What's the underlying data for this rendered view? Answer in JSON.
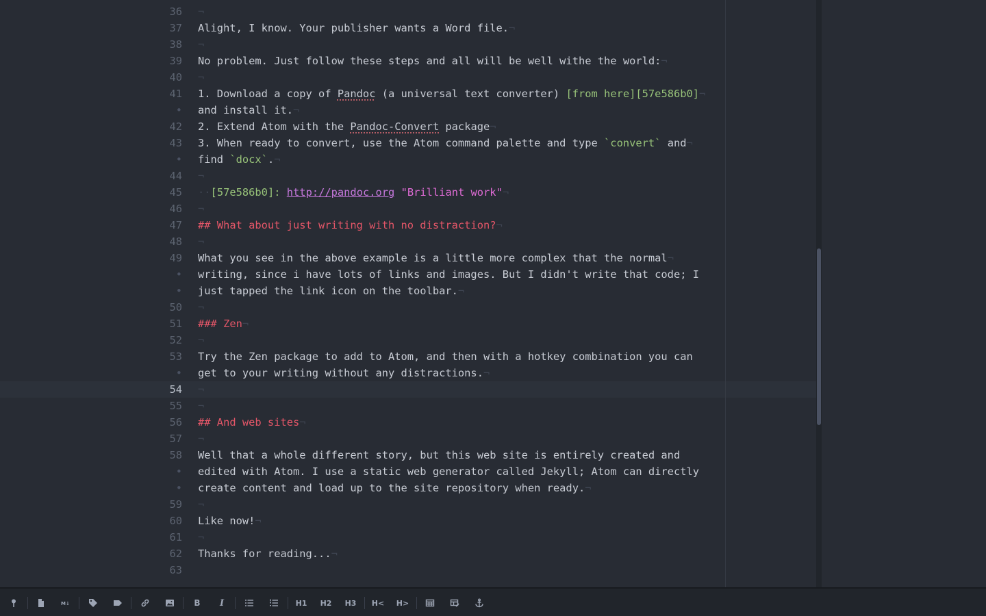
{
  "editor": {
    "lines": [
      {
        "num": "36",
        "parts": []
      },
      {
        "num": "37",
        "parts": [
          {
            "t": "Alight, I know. Your publisher wants a Word file."
          }
        ]
      },
      {
        "num": "38",
        "parts": []
      },
      {
        "num": "39",
        "parts": [
          {
            "t": "No problem. Just follow these steps and all will be well withe the world:"
          }
        ]
      },
      {
        "num": "40",
        "parts": []
      },
      {
        "num": "41",
        "parts": [
          {
            "t": "1. Download a copy of "
          },
          {
            "t": "Pandoc",
            "c": "sp"
          },
          {
            "t": " (a universal text converter) "
          },
          {
            "t": "[from here][57e586b0]",
            "c": "g"
          }
        ]
      },
      {
        "num": "•",
        "soft": true,
        "parts": [
          {
            "t": "and install it."
          }
        ]
      },
      {
        "num": "42",
        "parts": [
          {
            "t": "2. Extend Atom with the "
          },
          {
            "t": "Pandoc-Convert",
            "c": "sp"
          },
          {
            "t": " package"
          }
        ]
      },
      {
        "num": "43",
        "parts": [
          {
            "t": "3. When ready to convert, use the Atom command palette and type "
          },
          {
            "t": "`convert`",
            "c": "g"
          },
          {
            "t": " and"
          }
        ]
      },
      {
        "num": "•",
        "soft": true,
        "parts": [
          {
            "t": "find "
          },
          {
            "t": "`docx`",
            "c": "g"
          },
          {
            "t": "."
          }
        ]
      },
      {
        "num": "44",
        "parts": []
      },
      {
        "num": "45",
        "indent": "··",
        "parts": [
          {
            "t": "[57e586b0]:",
            "c": "g"
          },
          {
            "t": " "
          },
          {
            "t": "http://pandoc.org",
            "c": "m"
          },
          {
            "t": " "
          },
          {
            "t": "\"Brilliant work\"",
            "c": "p"
          }
        ]
      },
      {
        "num": "46",
        "parts": []
      },
      {
        "num": "47",
        "parts": [
          {
            "t": "## What about just writing with no distraction?",
            "c": "h"
          }
        ]
      },
      {
        "num": "48",
        "parts": []
      },
      {
        "num": "49",
        "parts": [
          {
            "t": "What you see in the above example is a little more complex that the normal"
          }
        ]
      },
      {
        "num": "•",
        "soft": true,
        "parts": [
          {
            "t": "writing, since i have lots of links and images. But I didn't write that code; I"
          }
        ],
        "noeol": true
      },
      {
        "num": "•",
        "soft": true,
        "parts": [
          {
            "t": "just tapped the link icon on the toolbar."
          }
        ]
      },
      {
        "num": "50",
        "parts": []
      },
      {
        "num": "51",
        "parts": [
          {
            "t": "### Zen",
            "c": "h"
          }
        ]
      },
      {
        "num": "52",
        "parts": []
      },
      {
        "num": "53",
        "parts": [
          {
            "t": "Try the Zen package to add to Atom, and then with a hotkey combination you can"
          }
        ],
        "noeol": true
      },
      {
        "num": "•",
        "soft": true,
        "parts": [
          {
            "t": "get to your writing without any distractions."
          }
        ]
      },
      {
        "num": "54",
        "cursor": true,
        "parts": []
      },
      {
        "num": "55",
        "parts": []
      },
      {
        "num": "56",
        "parts": [
          {
            "t": "## And web sites",
            "c": "h"
          }
        ]
      },
      {
        "num": "57",
        "parts": []
      },
      {
        "num": "58",
        "parts": [
          {
            "t": "Well that a whole different story, but this web site is entirely created and"
          }
        ],
        "noeol": true
      },
      {
        "num": "•",
        "soft": true,
        "parts": [
          {
            "t": "edited with Atom. I use a static web generator called Jekyll; Atom can directly"
          }
        ],
        "noeol": true
      },
      {
        "num": "•",
        "soft": true,
        "parts": [
          {
            "t": "create content and load up to the site repository when ready."
          }
        ]
      },
      {
        "num": "59",
        "parts": []
      },
      {
        "num": "60",
        "parts": [
          {
            "t": "Like now!"
          }
        ]
      },
      {
        "num": "61",
        "parts": []
      },
      {
        "num": "62",
        "parts": [
          {
            "t": "Thanks for reading..."
          }
        ]
      },
      {
        "num": "63",
        "parts": [],
        "noeol": true
      }
    ],
    "eol_marker": "¬"
  },
  "toolbar": {
    "items": [
      {
        "name": "toolbar-pin-icon",
        "icon": "pin"
      },
      {
        "sep": true
      },
      {
        "name": "toolbar-new-file-icon",
        "icon": "file"
      },
      {
        "name": "toolbar-markdown-preview-icon",
        "icon": "markdown"
      },
      {
        "sep": true
      },
      {
        "name": "toolbar-tag-icon",
        "icon": "tag"
      },
      {
        "name": "toolbar-label-icon",
        "icon": "label"
      },
      {
        "sep": true
      },
      {
        "name": "toolbar-link-icon",
        "icon": "link"
      },
      {
        "name": "toolbar-image-icon",
        "icon": "image"
      },
      {
        "sep": true
      },
      {
        "name": "toolbar-bold-button",
        "text": "B"
      },
      {
        "name": "toolbar-italic-button",
        "text": "I",
        "italic": true
      },
      {
        "sep": true
      },
      {
        "name": "toolbar-bullet-list-icon",
        "icon": "ul"
      },
      {
        "name": "toolbar-numbered-list-icon",
        "icon": "ol"
      },
      {
        "sep": true
      },
      {
        "name": "toolbar-h1-button",
        "text": "H1"
      },
      {
        "name": "toolbar-h2-button",
        "text": "H2"
      },
      {
        "name": "toolbar-h3-button",
        "text": "H3"
      },
      {
        "sep": true
      },
      {
        "name": "toolbar-heading-decrease-button",
        "text": "H<"
      },
      {
        "name": "toolbar-heading-increase-button",
        "text": "H>"
      },
      {
        "sep": true
      },
      {
        "name": "toolbar-table-icon",
        "icon": "table"
      },
      {
        "name": "toolbar-format-table-icon",
        "icon": "tableedit"
      },
      {
        "name": "toolbar-anchor-icon",
        "icon": "anchor"
      }
    ]
  }
}
